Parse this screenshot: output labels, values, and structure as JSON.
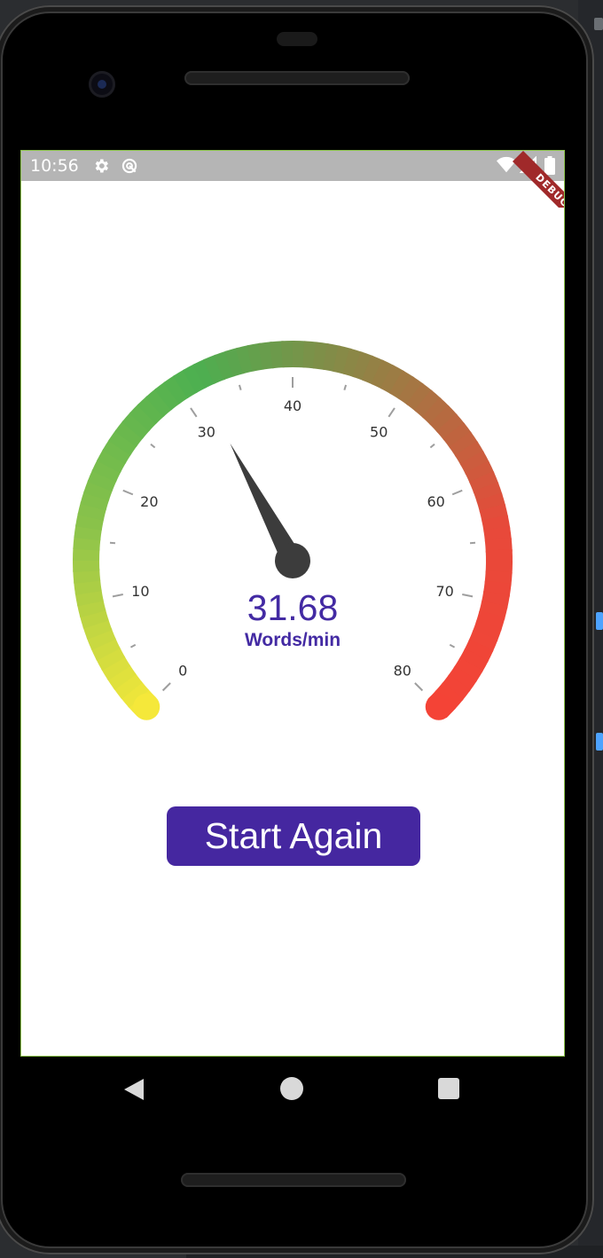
{
  "status_bar": {
    "time": "10:56",
    "icons": [
      "gear-icon",
      "sync-icon",
      "wifi-icon",
      "signal-icon",
      "battery-icon"
    ],
    "debug_banner": "DEBUG"
  },
  "gauge": {
    "min": 0,
    "max": 80,
    "value": 31.68,
    "value_text": "31.68",
    "unit": "Words/min",
    "tick_labels": [
      "0",
      "10",
      "20",
      "30",
      "40",
      "50",
      "60",
      "70",
      "80"
    ],
    "gradient_colors": [
      "#f5e83a",
      "#8bc34a",
      "#4caf50",
      "#9a7d44",
      "#e8493a",
      "#f44336"
    ]
  },
  "button": {
    "label": "Start Again",
    "color": "#4527a0"
  },
  "nav": {
    "icons": [
      "back-icon",
      "home-icon",
      "recent-apps-icon"
    ]
  }
}
